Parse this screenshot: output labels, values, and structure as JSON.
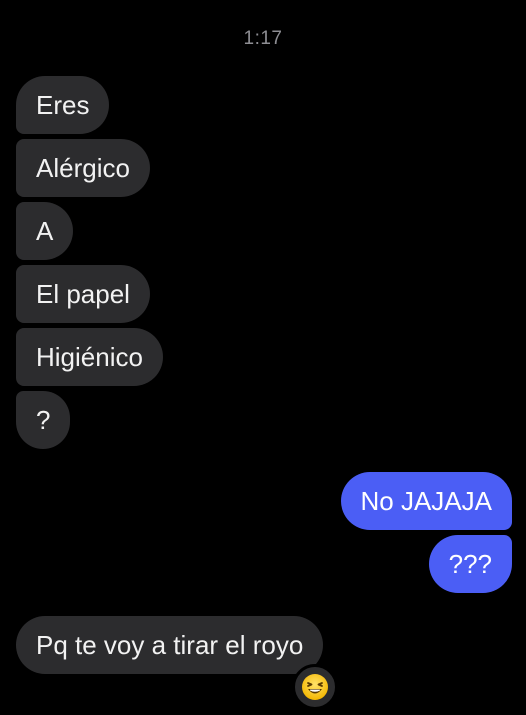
{
  "header": {
    "timestamp": "1:17"
  },
  "messages": [
    {
      "direction": "received",
      "text": "Eres"
    },
    {
      "direction": "received",
      "text": "Alérgico"
    },
    {
      "direction": "received",
      "text": "A"
    },
    {
      "direction": "received",
      "text": "El papel"
    },
    {
      "direction": "received",
      "text": "Higiénico"
    },
    {
      "direction": "received",
      "text": "?"
    },
    {
      "direction": "sent",
      "text": "No JAJAJA"
    },
    {
      "direction": "sent",
      "text": "???"
    },
    {
      "direction": "received",
      "text": "Pq te voy a tirar el royo"
    }
  ],
  "reaction": {
    "icon": "laughing-face-icon",
    "target_message": "Pq te voy a tirar el royo"
  },
  "colors": {
    "background": "#000000",
    "received_bubble": "#2c2c2e",
    "sent_bubble": "#4b5ef5",
    "timestamp": "#8e8e93"
  }
}
